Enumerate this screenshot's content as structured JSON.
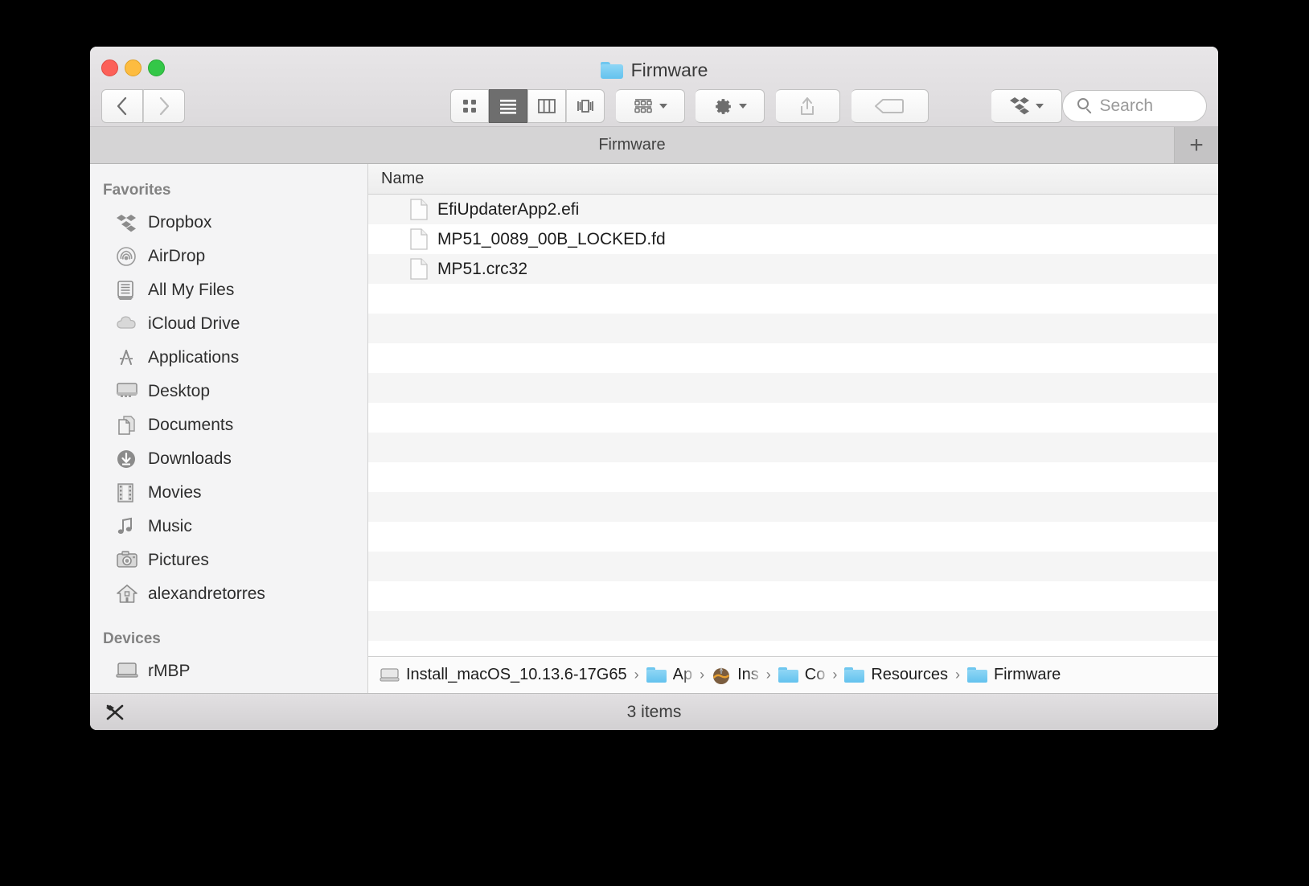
{
  "window": {
    "title": "Firmware",
    "title_icon": "folder-icon",
    "traffic_lights": [
      "close",
      "minimize",
      "zoom"
    ]
  },
  "toolbar": {
    "back_label": "‹",
    "forward_label": "›",
    "views": [
      {
        "name": "icon-view",
        "label": "icon-view-icon",
        "active": false
      },
      {
        "name": "list-view",
        "label": "list-view-icon",
        "active": true
      },
      {
        "name": "column-view",
        "label": "column-view-icon",
        "active": false
      },
      {
        "name": "coverflow-view",
        "label": "coverflow-view-icon",
        "active": false
      }
    ],
    "arrange_label": "arrange-icon",
    "action_label": "gear-icon",
    "share_label": "share-icon",
    "tags_label": "tag-icon",
    "dropbox_label": "dropbox-icon"
  },
  "search": {
    "placeholder": "Search",
    "value": ""
  },
  "tabs": {
    "items": [
      {
        "label": "Firmware",
        "active": true
      }
    ],
    "new_tab_label": "+"
  },
  "sidebar": {
    "sections": [
      {
        "header": "Favorites",
        "items": [
          {
            "label": "Dropbox",
            "icon": "dropbox-icon"
          },
          {
            "label": "AirDrop",
            "icon": "airdrop-icon"
          },
          {
            "label": "All My Files",
            "icon": "all-my-files-icon"
          },
          {
            "label": "iCloud Drive",
            "icon": "icloud-icon"
          },
          {
            "label": "Applications",
            "icon": "applications-icon"
          },
          {
            "label": "Desktop",
            "icon": "desktop-icon"
          },
          {
            "label": "Documents",
            "icon": "documents-icon"
          },
          {
            "label": "Downloads",
            "icon": "downloads-icon"
          },
          {
            "label": "Movies",
            "icon": "movies-icon"
          },
          {
            "label": "Music",
            "icon": "music-icon"
          },
          {
            "label": "Pictures",
            "icon": "pictures-icon"
          },
          {
            "label": "alexandretorres",
            "icon": "home-icon"
          }
        ]
      },
      {
        "header": "Devices",
        "items": [
          {
            "label": "rMBP",
            "icon": "computer-icon"
          }
        ]
      }
    ]
  },
  "file_list": {
    "columns": [
      "Name"
    ],
    "rows": [
      {
        "name": "EfiUpdaterApp2.efi",
        "icon": "document-icon"
      },
      {
        "name": "MP51_0089_00B_LOCKED.fd",
        "icon": "document-icon"
      },
      {
        "name": "MP51.crc32",
        "icon": "document-icon"
      }
    ],
    "empty_row_count": 14
  },
  "breadcrumb": [
    {
      "label": "Install_macOS_10.13.6-17G65",
      "icon": "disk-icon",
      "truncated": false
    },
    {
      "label": "Ap",
      "icon": "folder-icon",
      "truncated": true
    },
    {
      "label": "Ins",
      "icon": "app-icon",
      "truncated": true
    },
    {
      "label": "Co",
      "icon": "folder-icon",
      "truncated": true
    },
    {
      "label": "Resources",
      "icon": "folder-icon",
      "truncated": false
    },
    {
      "label": "Firmware",
      "icon": "folder-icon",
      "truncated": false
    }
  ],
  "breadcrumb_separator": "›",
  "status": {
    "item_count": "3 items",
    "icon": "dropbox-unsynced-icon"
  },
  "colors": {
    "folder_blue": "#6fc7ef",
    "toolbar_bg": "#e4e2e4",
    "sidebar_bg": "#f4f4f5",
    "active_view_bg": "#6e6e6e"
  }
}
